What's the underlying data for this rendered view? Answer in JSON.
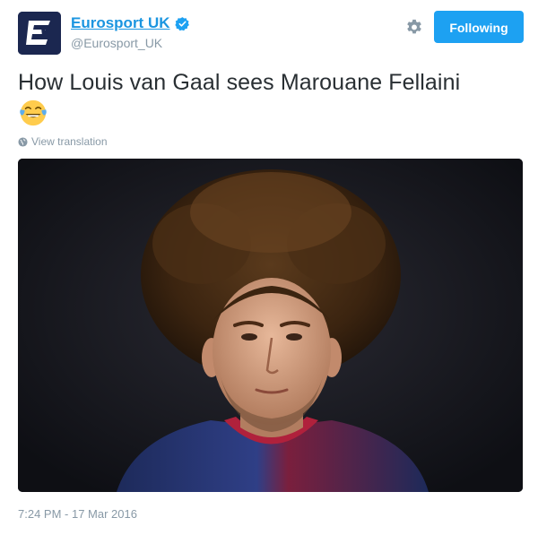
{
  "account": {
    "display_name": "Eurosport UK",
    "handle": "@Eurosport_UK",
    "verified": true,
    "avatar_icon": "eurosport-e-logo",
    "avatar_color": "#1b2750"
  },
  "header": {
    "settings_icon": "gear-icon",
    "follow_button_label": "Following",
    "follow_button_color": "#1da1f2"
  },
  "tweet": {
    "text": "How Louis van Gaal sees Marouane Fellaini",
    "emoji_icon": "face-with-tears-of-joy-icon",
    "translation_link": "View translation",
    "translation_icon": "globe-icon",
    "media": "photo-footballer-with-afro-hair",
    "timestamp": "7:24 PM - 17 Mar 2016"
  },
  "colors": {
    "link": "#1b95e0",
    "secondary_text": "#8899a6",
    "primary_text": "#292f33"
  }
}
